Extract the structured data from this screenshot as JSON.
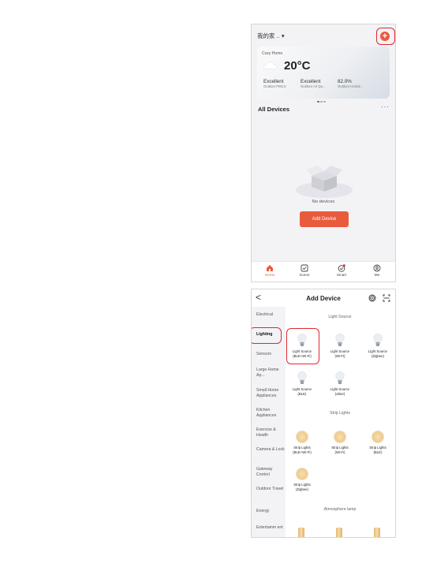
{
  "home": {
    "title": "我的家 .. ▾",
    "weather": {
      "location": "Cozy Home",
      "temperature": "20°C",
      "stats": [
        {
          "value": "Excellent",
          "label": "Outdoor PM2.5"
        },
        {
          "value": "Excellent",
          "label": "Outdoor Air Qu..."
        },
        {
          "value": "82.0%",
          "label": "Outdoor Humid..."
        }
      ]
    },
    "all_devices_label": "All Devices",
    "more_label": "···",
    "empty_text": "No devices",
    "add_device_label": "Add Device",
    "tabs": [
      {
        "label": "Home",
        "icon": "home-icon"
      },
      {
        "label": "Scene",
        "icon": "scene-icon"
      },
      {
        "label": "Smart",
        "icon": "smart-icon"
      },
      {
        "label": "Me",
        "icon": "me-icon"
      }
    ]
  },
  "add_device": {
    "back_label": "<",
    "title": "Add Device",
    "categories": [
      "Electrical",
      "Lighting",
      "Sensors",
      "Large Home Ap...",
      "Small Home Appliances",
      "Kitchen Appliances",
      "Exercise & Health",
      "Camera & Lock",
      "Gateway Control",
      "Outdoor Travel",
      "Energy",
      "Entertainm ent"
    ],
    "selected_category": "Lighting",
    "sections": {
      "light_source": "Light Source",
      "strip_lights": "Strip Lights",
      "atmosphere": "Atmosphere lamp"
    },
    "light_devices": [
      {
        "name": "Light Source",
        "sub": "(BLE+Wi-Fi)"
      },
      {
        "name": "Light Source",
        "sub": "(Wi-Fi)"
      },
      {
        "name": "Light Source",
        "sub": "(Zigbee)"
      },
      {
        "name": "Light Source",
        "sub": "(BLE)"
      },
      {
        "name": "Light Source",
        "sub": "(other)"
      }
    ],
    "strip_devices": [
      {
        "name": "Strip Lights",
        "sub": "(BLE+Wi-Fi)"
      },
      {
        "name": "Strip Lights",
        "sub": "(Wi-Fi)"
      },
      {
        "name": "Strip Lights",
        "sub": "(BLE)"
      },
      {
        "name": "Strip Lights",
        "sub": "(Zigbee)"
      }
    ]
  },
  "colors": {
    "accent": "#e95b3d",
    "highlight": "#e0282f"
  }
}
